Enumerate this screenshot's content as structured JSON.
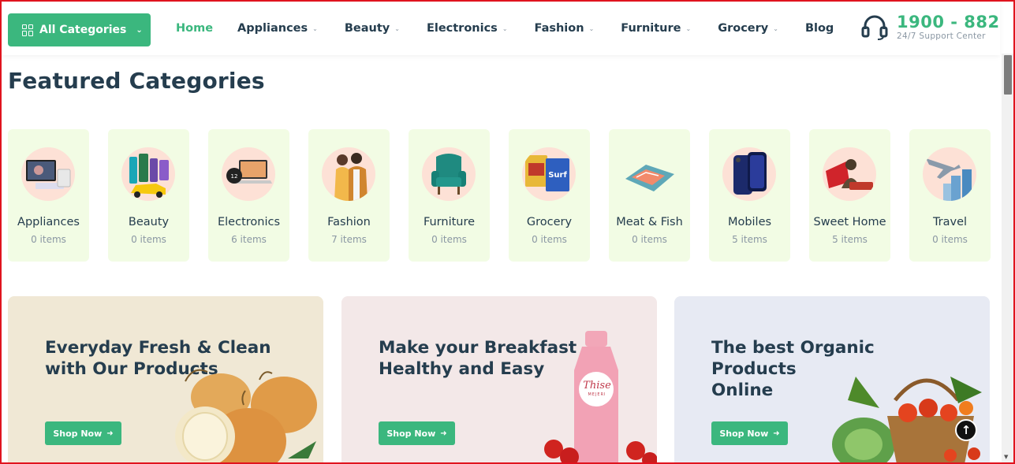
{
  "header": {
    "all_categories_label": "All Categories",
    "nav": [
      {
        "label": "Home",
        "active": true,
        "dropdown": false
      },
      {
        "label": "Appliances",
        "active": false,
        "dropdown": true
      },
      {
        "label": "Beauty",
        "active": false,
        "dropdown": true
      },
      {
        "label": "Electronics",
        "active": false,
        "dropdown": true
      },
      {
        "label": "Fashion",
        "active": false,
        "dropdown": true
      },
      {
        "label": "Furniture",
        "active": false,
        "dropdown": true
      },
      {
        "label": "Grocery",
        "active": false,
        "dropdown": true
      },
      {
        "label": "Blog",
        "active": false,
        "dropdown": false
      }
    ],
    "support_number": "1900 - 882",
    "support_label": "24/7 Support Center"
  },
  "featured": {
    "title": "Featured Categories",
    "categories": [
      {
        "name": "Appliances",
        "count": "0 items",
        "icon": "tv-icon"
      },
      {
        "name": "Beauty",
        "count": "0 items",
        "icon": "cosmetics-icon"
      },
      {
        "name": "Electronics",
        "count": "6 items",
        "icon": "laptop-icon"
      },
      {
        "name": "Fashion",
        "count": "7 items",
        "icon": "couple-icon"
      },
      {
        "name": "Furniture",
        "count": "0 items",
        "icon": "armchair-icon"
      },
      {
        "name": "Grocery",
        "count": "0 items",
        "icon": "grocery-icon"
      },
      {
        "name": "Meat & Fish",
        "count": "0 items",
        "icon": "fish-icon"
      },
      {
        "name": "Mobiles",
        "count": "5 items",
        "icon": "phone-icon"
      },
      {
        "name": "Sweet Home",
        "count": "5 items",
        "icon": "home-decor-icon"
      },
      {
        "name": "Travel",
        "count": "0 items",
        "icon": "airplane-icon"
      }
    ]
  },
  "banners": [
    {
      "title_line1": "Everyday Fresh & Clean",
      "title_line2": "with Our Products",
      "button": "Shop Now",
      "bg": "#f0e8d5",
      "art": "onion-illustration"
    },
    {
      "title_line1": "Make your Breakfast",
      "title_line2": "Healthy and Easy",
      "button": "Shop Now",
      "bg": "#f3e8e8",
      "art": "milk-bottle-illustration",
      "bottle_text": "Thise",
      "bottle_sub": "MEJERI"
    },
    {
      "title_line1": "The best Organic Products",
      "title_line2": "Online",
      "button": "Shop Now",
      "bg": "#e7eaf3",
      "art": "vegetable-basket-illustration"
    }
  ],
  "colors": {
    "brand": "#3bb77e",
    "text": "#253d4e",
    "muted": "#8a97a3",
    "card_bg": "#f2fce4"
  }
}
